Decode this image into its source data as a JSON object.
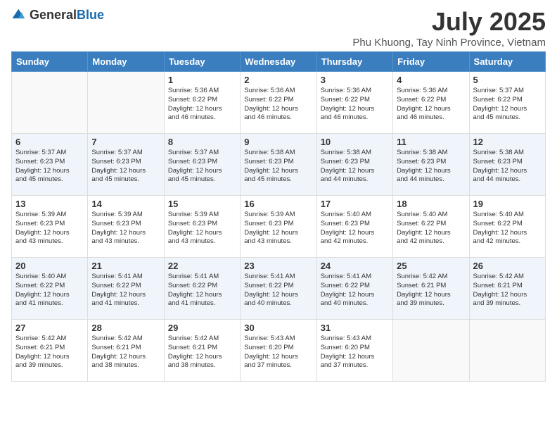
{
  "header": {
    "logo_general": "General",
    "logo_blue": "Blue",
    "month": "July 2025",
    "location": "Phu Khuong, Tay Ninh Province, Vietnam"
  },
  "days_of_week": [
    "Sunday",
    "Monday",
    "Tuesday",
    "Wednesday",
    "Thursday",
    "Friday",
    "Saturday"
  ],
  "weeks": [
    [
      {
        "day": "",
        "info": ""
      },
      {
        "day": "",
        "info": ""
      },
      {
        "day": "1",
        "info": "Sunrise: 5:36 AM\nSunset: 6:22 PM\nDaylight: 12 hours\nand 46 minutes."
      },
      {
        "day": "2",
        "info": "Sunrise: 5:36 AM\nSunset: 6:22 PM\nDaylight: 12 hours\nand 46 minutes."
      },
      {
        "day": "3",
        "info": "Sunrise: 5:36 AM\nSunset: 6:22 PM\nDaylight: 12 hours\nand 46 minutes."
      },
      {
        "day": "4",
        "info": "Sunrise: 5:36 AM\nSunset: 6:22 PM\nDaylight: 12 hours\nand 46 minutes."
      },
      {
        "day": "5",
        "info": "Sunrise: 5:37 AM\nSunset: 6:22 PM\nDaylight: 12 hours\nand 45 minutes."
      }
    ],
    [
      {
        "day": "6",
        "info": "Sunrise: 5:37 AM\nSunset: 6:23 PM\nDaylight: 12 hours\nand 45 minutes."
      },
      {
        "day": "7",
        "info": "Sunrise: 5:37 AM\nSunset: 6:23 PM\nDaylight: 12 hours\nand 45 minutes."
      },
      {
        "day": "8",
        "info": "Sunrise: 5:37 AM\nSunset: 6:23 PM\nDaylight: 12 hours\nand 45 minutes."
      },
      {
        "day": "9",
        "info": "Sunrise: 5:38 AM\nSunset: 6:23 PM\nDaylight: 12 hours\nand 45 minutes."
      },
      {
        "day": "10",
        "info": "Sunrise: 5:38 AM\nSunset: 6:23 PM\nDaylight: 12 hours\nand 44 minutes."
      },
      {
        "day": "11",
        "info": "Sunrise: 5:38 AM\nSunset: 6:23 PM\nDaylight: 12 hours\nand 44 minutes."
      },
      {
        "day": "12",
        "info": "Sunrise: 5:38 AM\nSunset: 6:23 PM\nDaylight: 12 hours\nand 44 minutes."
      }
    ],
    [
      {
        "day": "13",
        "info": "Sunrise: 5:39 AM\nSunset: 6:23 PM\nDaylight: 12 hours\nand 43 minutes."
      },
      {
        "day": "14",
        "info": "Sunrise: 5:39 AM\nSunset: 6:23 PM\nDaylight: 12 hours\nand 43 minutes."
      },
      {
        "day": "15",
        "info": "Sunrise: 5:39 AM\nSunset: 6:23 PM\nDaylight: 12 hours\nand 43 minutes."
      },
      {
        "day": "16",
        "info": "Sunrise: 5:39 AM\nSunset: 6:23 PM\nDaylight: 12 hours\nand 43 minutes."
      },
      {
        "day": "17",
        "info": "Sunrise: 5:40 AM\nSunset: 6:23 PM\nDaylight: 12 hours\nand 42 minutes."
      },
      {
        "day": "18",
        "info": "Sunrise: 5:40 AM\nSunset: 6:22 PM\nDaylight: 12 hours\nand 42 minutes."
      },
      {
        "day": "19",
        "info": "Sunrise: 5:40 AM\nSunset: 6:22 PM\nDaylight: 12 hours\nand 42 minutes."
      }
    ],
    [
      {
        "day": "20",
        "info": "Sunrise: 5:40 AM\nSunset: 6:22 PM\nDaylight: 12 hours\nand 41 minutes."
      },
      {
        "day": "21",
        "info": "Sunrise: 5:41 AM\nSunset: 6:22 PM\nDaylight: 12 hours\nand 41 minutes."
      },
      {
        "day": "22",
        "info": "Sunrise: 5:41 AM\nSunset: 6:22 PM\nDaylight: 12 hours\nand 41 minutes."
      },
      {
        "day": "23",
        "info": "Sunrise: 5:41 AM\nSunset: 6:22 PM\nDaylight: 12 hours\nand 40 minutes."
      },
      {
        "day": "24",
        "info": "Sunrise: 5:41 AM\nSunset: 6:22 PM\nDaylight: 12 hours\nand 40 minutes."
      },
      {
        "day": "25",
        "info": "Sunrise: 5:42 AM\nSunset: 6:21 PM\nDaylight: 12 hours\nand 39 minutes."
      },
      {
        "day": "26",
        "info": "Sunrise: 5:42 AM\nSunset: 6:21 PM\nDaylight: 12 hours\nand 39 minutes."
      }
    ],
    [
      {
        "day": "27",
        "info": "Sunrise: 5:42 AM\nSunset: 6:21 PM\nDaylight: 12 hours\nand 39 minutes."
      },
      {
        "day": "28",
        "info": "Sunrise: 5:42 AM\nSunset: 6:21 PM\nDaylight: 12 hours\nand 38 minutes."
      },
      {
        "day": "29",
        "info": "Sunrise: 5:42 AM\nSunset: 6:21 PM\nDaylight: 12 hours\nand 38 minutes."
      },
      {
        "day": "30",
        "info": "Sunrise: 5:43 AM\nSunset: 6:20 PM\nDaylight: 12 hours\nand 37 minutes."
      },
      {
        "day": "31",
        "info": "Sunrise: 5:43 AM\nSunset: 6:20 PM\nDaylight: 12 hours\nand 37 minutes."
      },
      {
        "day": "",
        "info": ""
      },
      {
        "day": "",
        "info": ""
      }
    ]
  ]
}
